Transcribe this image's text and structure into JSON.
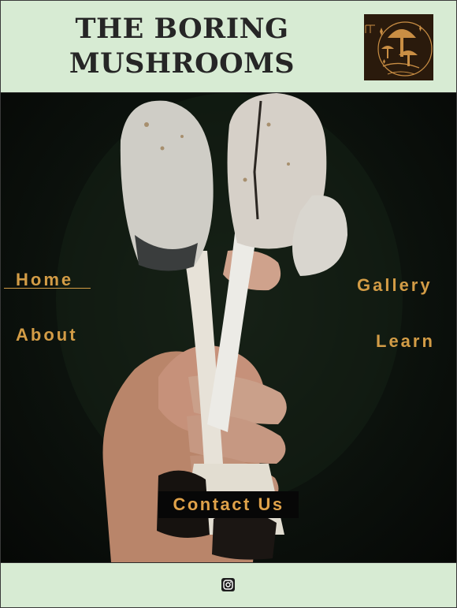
{
  "header": {
    "title_line1": "THE BORING",
    "title_line2": "MUSHROOMS",
    "logo_icon": "mushroom-logo-icon"
  },
  "nav": {
    "home": "Home",
    "about": "About",
    "gallery": "Gallery",
    "learn": "Learn",
    "contact": "Contact Us"
  },
  "footer": {
    "social_icon": "instagram-icon"
  },
  "colors": {
    "header_bg": "#d7ebd3",
    "accent": "#d39c46",
    "hero_bg": "#0c120d"
  }
}
